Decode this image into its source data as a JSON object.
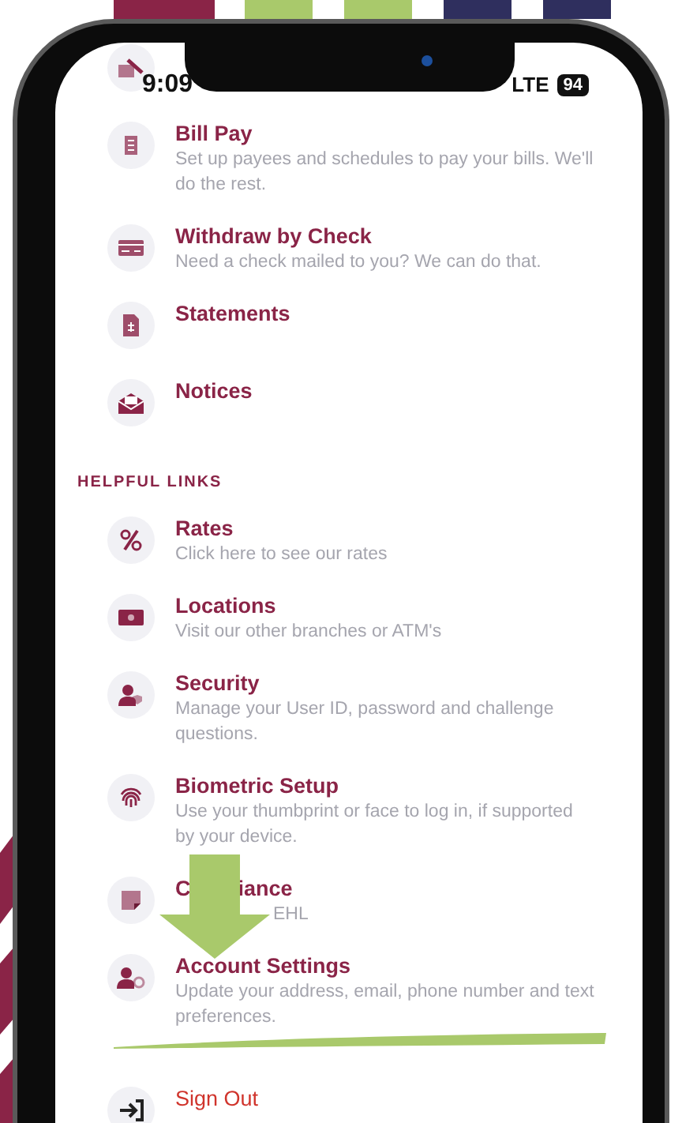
{
  "status_bar": {
    "time": "9:09",
    "network": "LTE",
    "battery": "94"
  },
  "sections": [
    {
      "items": [
        {
          "title": "Bill Pay",
          "subtitle": "Set up payees and schedules to pay your bills. We'll do the rest."
        },
        {
          "title": "Withdraw by Check",
          "subtitle": "Need a check mailed to you? We can do that."
        },
        {
          "title": "Statements"
        },
        {
          "title": "Notices"
        }
      ]
    },
    {
      "header": "HELPFUL LINKS",
      "items": [
        {
          "title": "Rates",
          "subtitle": "Click here to see our rates"
        },
        {
          "title": "Locations",
          "subtitle": "Visit our other branches or ATM's"
        },
        {
          "title": "Security",
          "subtitle": "Manage your User ID, password and challenge questions."
        },
        {
          "title": "Biometric Setup",
          "subtitle": "Use your thumbprint or face to log in, if supported by your device."
        },
        {
          "title_parts": [
            "C",
            "iance"
          ],
          "subtitle": "EHL"
        },
        {
          "title": "Account Settings",
          "subtitle": "Update your address, email, phone number and text preferences."
        }
      ]
    }
  ],
  "sign_out": {
    "title": "Sign Out"
  }
}
